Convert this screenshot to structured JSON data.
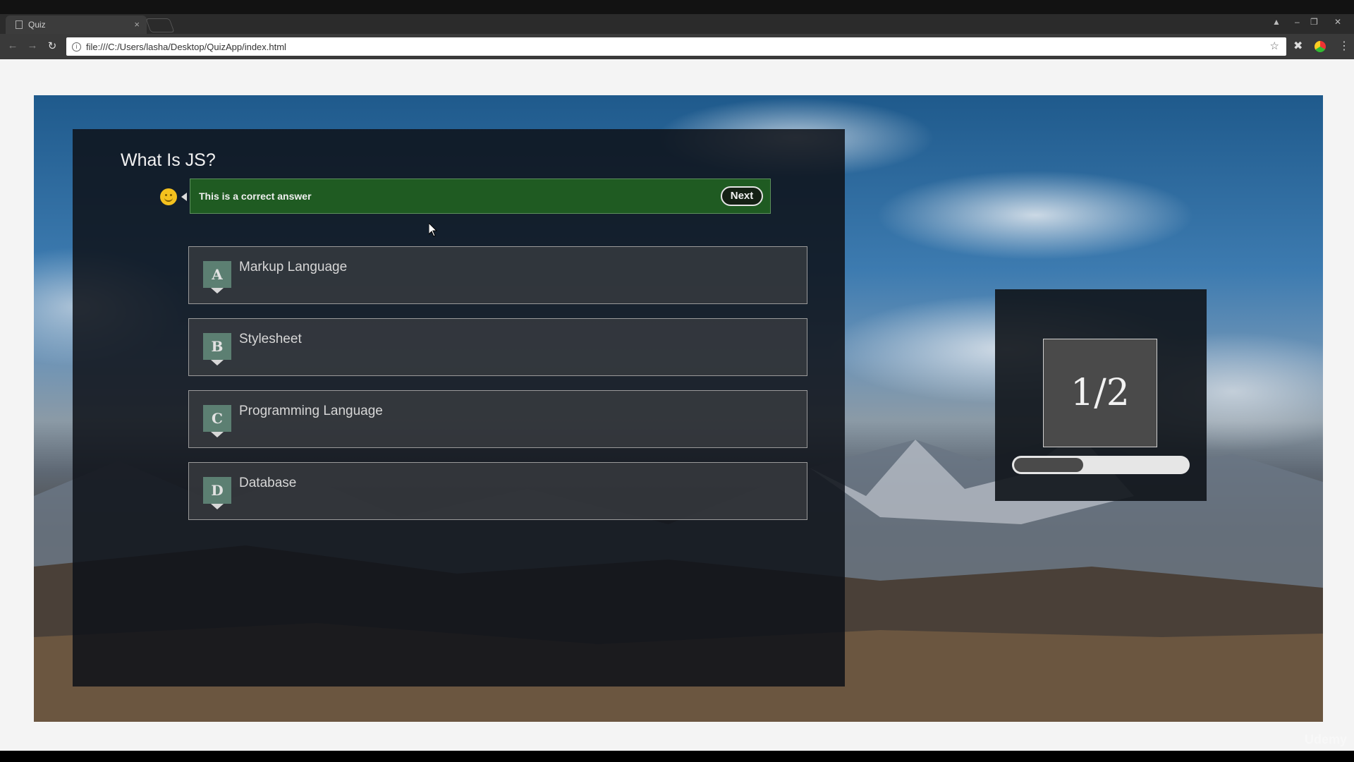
{
  "browser": {
    "tab_title": "Quiz",
    "tab_close": "×",
    "url": "file:///C:/Users/lasha/Desktop/QuizApp/index.html",
    "nav": {
      "back": "←",
      "forward": "→",
      "reload": "↻"
    },
    "window_controls": {
      "minimize": "–",
      "restore": "❐",
      "close": "✕",
      "user": "▲"
    },
    "star": "☆",
    "menu": "⋮"
  },
  "quiz": {
    "question": "What Is JS?",
    "feedback": {
      "message": "This is a correct answer",
      "next_label": "Next",
      "icon": "smiley-icon"
    },
    "options": [
      {
        "letter": "A",
        "label": "Markup Language"
      },
      {
        "letter": "B",
        "label": "Stylesheet"
      },
      {
        "letter": "C",
        "label": "Programming Language"
      },
      {
        "letter": "D",
        "label": "Database"
      }
    ],
    "progress": {
      "counter": "1/2",
      "fraction": 0.5
    }
  },
  "watermark": "Udemy",
  "colors": {
    "feedback_bg": "#1f5b22",
    "option_letter_bg": "#5c7f72",
    "progress_fill": "#4a4a4a"
  }
}
